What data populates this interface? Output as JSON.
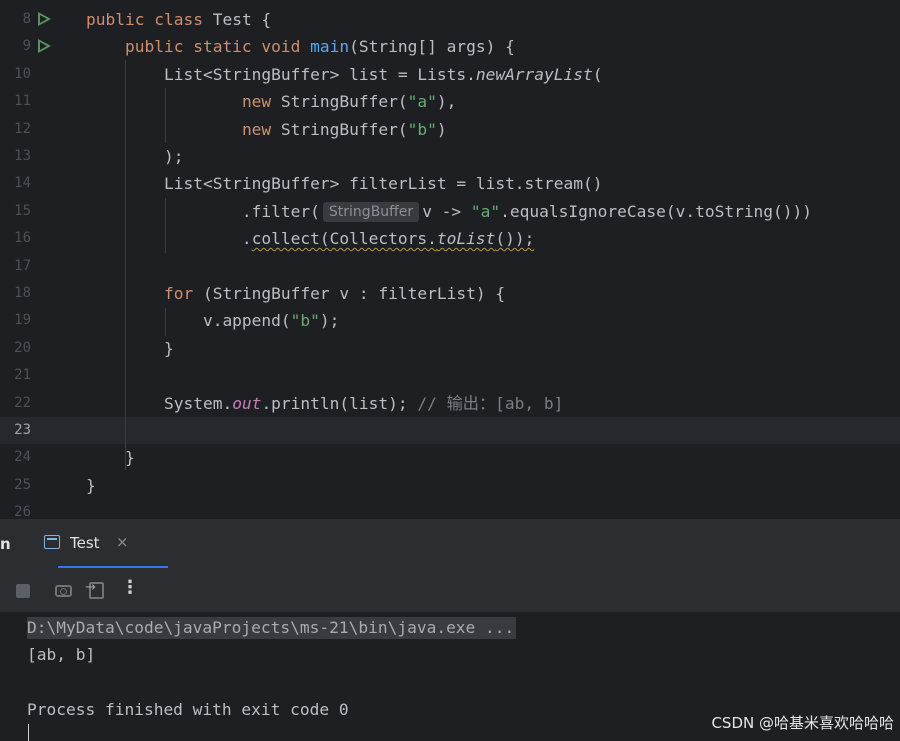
{
  "editor": {
    "lines": [
      {
        "num": "8",
        "run": true,
        "tokens": [
          {
            "t": "public class ",
            "c": "kw"
          },
          {
            "t": "Test {",
            "c": ""
          }
        ]
      },
      {
        "num": "9",
        "run": true,
        "tokens": [
          {
            "t": "    "
          },
          {
            "t": "public static void ",
            "c": "kw"
          },
          {
            "t": "main",
            "c": "fn"
          },
          {
            "t": "(String[] args) {"
          }
        ]
      },
      {
        "num": "10",
        "tokens": [
          {
            "t": "        List<StringBuffer> list = Lists."
          },
          {
            "t": "newArrayList",
            "c": "st"
          },
          {
            "t": "("
          }
        ]
      },
      {
        "num": "11",
        "tokens": [
          {
            "t": "                "
          },
          {
            "t": "new ",
            "c": "kw"
          },
          {
            "t": "StringBuffer("
          },
          {
            "t": "\"a\"",
            "c": "str"
          },
          {
            "t": "),"
          }
        ]
      },
      {
        "num": "12",
        "tokens": [
          {
            "t": "                "
          },
          {
            "t": "new ",
            "c": "kw"
          },
          {
            "t": "StringBuffer("
          },
          {
            "t": "\"b\"",
            "c": "str"
          },
          {
            "t": ")"
          }
        ]
      },
      {
        "num": "13",
        "tokens": [
          {
            "t": "        );"
          }
        ]
      },
      {
        "num": "14",
        "tokens": [
          {
            "t": "        List<StringBuffer> filterList = list.stream()"
          }
        ]
      },
      {
        "num": "15",
        "tokens": [
          {
            "t": "                .filter("
          },
          {
            "t": "StringBuffer",
            "c": "hint"
          },
          {
            "t": "v -> "
          },
          {
            "t": "\"a\"",
            "c": "str"
          },
          {
            "t": ".equalsIgnoreCase(v.toString()))"
          }
        ]
      },
      {
        "num": "16",
        "tokens": [
          {
            "t": "                ."
          },
          {
            "t": "collect(Collectors.",
            "c": "warn"
          },
          {
            "t": "toList",
            "c": "warn st"
          },
          {
            "t": "());",
            "c": "warn"
          }
        ]
      },
      {
        "num": "17",
        "tokens": []
      },
      {
        "num": "18",
        "tokens": [
          {
            "t": "        "
          },
          {
            "t": "for ",
            "c": "kw"
          },
          {
            "t": "(StringBuffer v : filterList) {"
          }
        ]
      },
      {
        "num": "19",
        "tokens": [
          {
            "t": "            v.append("
          },
          {
            "t": "\"b\"",
            "c": "str"
          },
          {
            "t": ");"
          }
        ]
      },
      {
        "num": "20",
        "tokens": [
          {
            "t": "        }"
          }
        ]
      },
      {
        "num": "21",
        "tokens": []
      },
      {
        "num": "22",
        "tokens": [
          {
            "t": "        System."
          },
          {
            "t": "out",
            "c": "sfield"
          },
          {
            "t": ".println(list); "
          },
          {
            "t": "// 输出：[ab, b]",
            "c": "cmt"
          }
        ]
      },
      {
        "num": "23",
        "current": true,
        "tokens": []
      },
      {
        "num": "24",
        "tokens": [
          {
            "t": "    }"
          }
        ]
      },
      {
        "num": "25",
        "tokens": [
          {
            "t": "}"
          }
        ]
      },
      {
        "num": "26",
        "tokens": []
      }
    ]
  },
  "panel": {
    "side_label": "n",
    "tab_label": "Test",
    "tab_close": "×",
    "more": "⋮"
  },
  "console": {
    "command": "D:\\MyData\\code\\javaProjects\\ms-21\\bin\\java.exe ...",
    "output": "[ab, b]",
    "exit": "Process finished with exit code 0"
  },
  "watermark": "CSDN @哈基米喜欢哈哈哈"
}
